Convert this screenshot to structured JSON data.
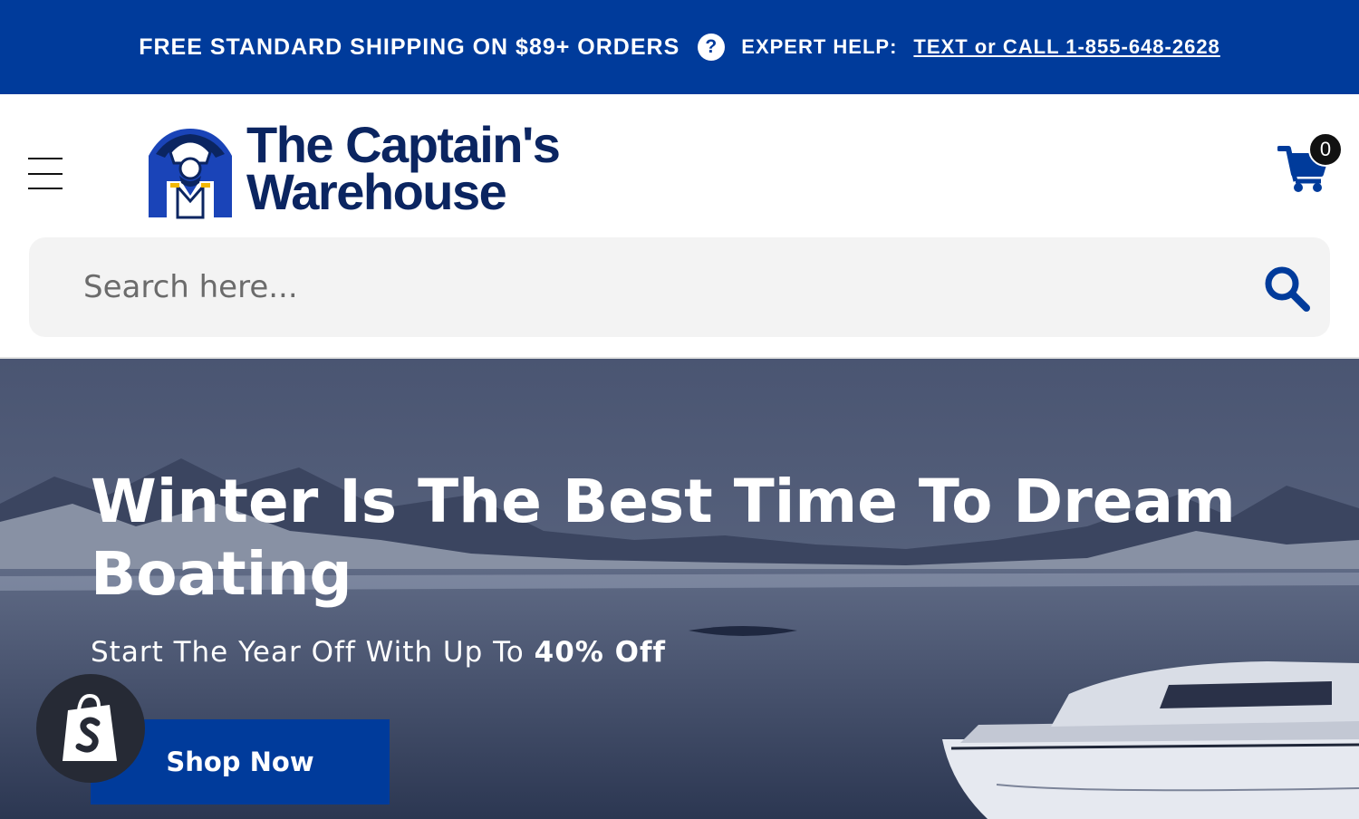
{
  "topbar": {
    "shipping": "FREE STANDARD SHIPPING ON $89+ ORDERS",
    "help_icon_glyph": "?",
    "help_label": "EXPERT HELP:",
    "call_link": "TEXT or CALL 1-855-648-2628",
    "background": "#003b9b"
  },
  "header": {
    "logo_line1": "The Captain's",
    "logo_line2": "Warehouse",
    "cart_count": "0",
    "cart_icon": "shopping-cart-icon",
    "menu_icon": "hamburger-menu-icon"
  },
  "search": {
    "placeholder": "Search here...",
    "icon": "search-icon"
  },
  "hero": {
    "headline": "Winter Is The Best Time To Dream Boating",
    "subtitle_prefix": "Start The Year Off With Up To ",
    "subtitle_bold": "40% Off",
    "button_label": "Shop Now"
  },
  "widgets": {
    "shopify_icon": "shopify-bag-icon"
  },
  "colors": {
    "brand_blue": "#003b9b",
    "logo_navy": "#0b2561"
  }
}
